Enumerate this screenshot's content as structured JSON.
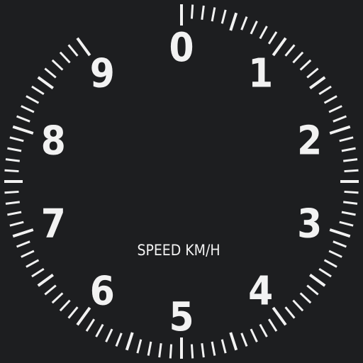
{
  "gauge": {
    "unit_label": "SPEED KM/H",
    "scale_labels": [
      "0",
      "1",
      "2",
      "3",
      "4",
      "5",
      "6",
      "7",
      "8",
      "9"
    ],
    "colors": {
      "background": "#1d1e20",
      "ticks": "#f2f2f2",
      "text": "#f2f2f2"
    }
  }
}
